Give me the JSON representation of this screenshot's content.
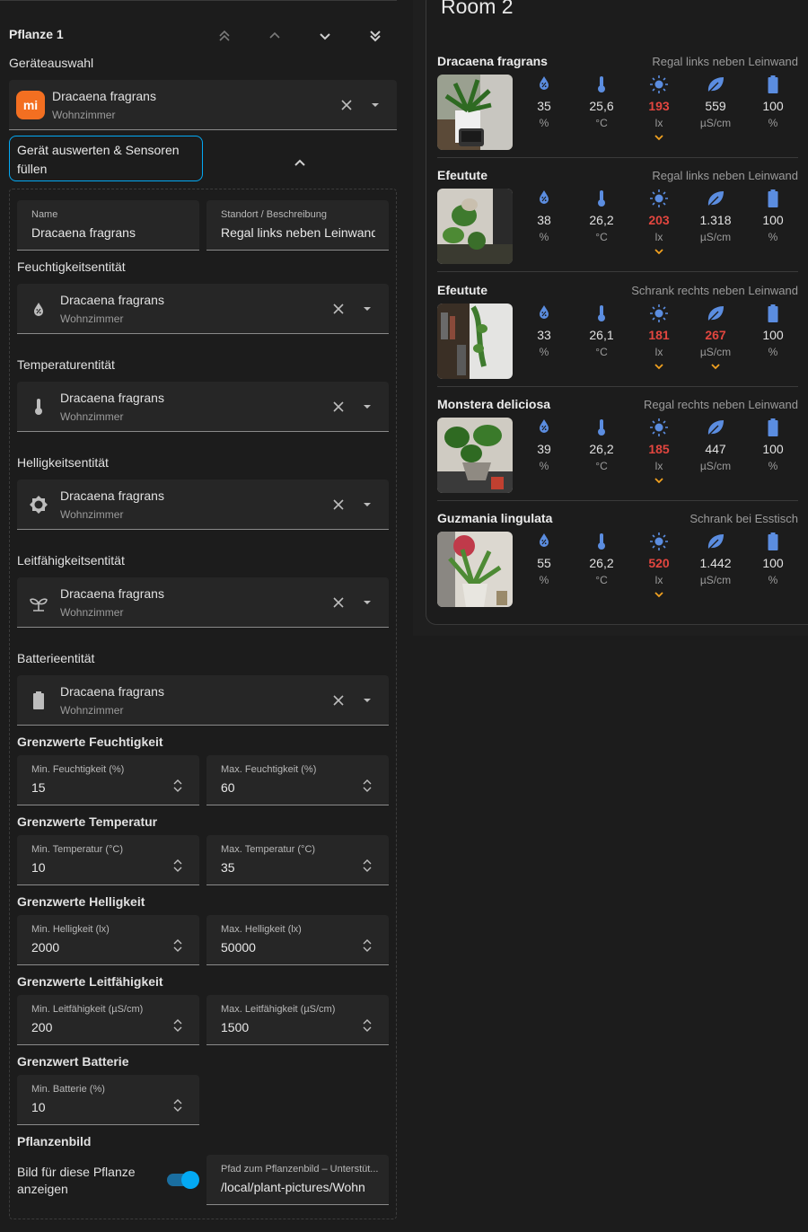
{
  "editor": {
    "plant_title": "Pflanze 1",
    "device_label": "Geräteauswahl",
    "device": {
      "name": "Dracaena fragrans",
      "area": "Wohnzimmer",
      "logo_text": "mi"
    },
    "evaluate_button": "Gerät auswerten & Sensoren füllen",
    "name_field": {
      "label": "Name",
      "value": "Dracaena fragrans"
    },
    "location_field": {
      "label": "Standort / Beschreibung",
      "value": "Regal links neben Leinwand"
    },
    "entities": [
      {
        "label": "Feuchtigkeitsentität",
        "name": "Dracaena fragrans",
        "area": "Wohnzimmer",
        "icon": "humidity-icon"
      },
      {
        "label": "Temperaturentität",
        "name": "Dracaena fragrans",
        "area": "Wohnzimmer",
        "icon": "thermometer-icon"
      },
      {
        "label": "Helligkeitsentität",
        "name": "Dracaena fragrans",
        "area": "Wohnzimmer",
        "icon": "brightness-icon"
      },
      {
        "label": "Leitfähigkeitsentität",
        "name": "Dracaena fragrans",
        "area": "Wohnzimmer",
        "icon": "sprout-icon"
      },
      {
        "label": "Batterieentität",
        "name": "Dracaena fragrans",
        "area": "Wohnzimmer",
        "icon": "battery-icon"
      }
    ],
    "thresholds": [
      {
        "title": "Grenzwerte Feuchtigkeit",
        "min_label": "Min. Feuchtigkeit (%)",
        "min": "15",
        "max_label": "Max. Feuchtigkeit (%)",
        "max": "60"
      },
      {
        "title": "Grenzwerte Temperatur",
        "min_label": "Min. Temperatur (°C)",
        "min": "10",
        "max_label": "Max. Temperatur (°C)",
        "max": "35"
      },
      {
        "title": "Grenzwerte Helligkeit",
        "min_label": "Min. Helligkeit (lx)",
        "min": "2000",
        "max_label": "Max. Helligkeit (lx)",
        "max": "50000"
      },
      {
        "title": "Grenzwerte Leitfähigkeit",
        "min_label": "Min. Leitfähigkeit (µS/cm)",
        "min": "200",
        "max_label": "Max. Leitfähigkeit (µS/cm)",
        "max": "1500"
      }
    ],
    "battery_threshold": {
      "title": "Grenzwert Batterie",
      "min_label": "Min. Batterie (%)",
      "min": "10"
    },
    "image_section": {
      "title": "Pflanzenbild",
      "toggle_label": "Bild für diese Pflanze anzeigen",
      "toggle_on": true,
      "path_label": "Pfad zum Pflanzenbild – Unterstüt...",
      "path_value": "/local/plant-pictures/Wohn"
    }
  },
  "card": {
    "title": "Room 2",
    "units": [
      "%",
      "°C",
      "lx",
      "µS/cm",
      "%"
    ],
    "plants": [
      {
        "name": "Dracaena fragrans",
        "location": "Regal links neben Leinwand",
        "values": [
          "35",
          "25,6",
          "193",
          "559",
          "100"
        ],
        "warn": [
          false,
          false,
          true,
          false,
          false
        ]
      },
      {
        "name": "Efeutute",
        "location": "Regal links neben Leinwand",
        "values": [
          "38",
          "26,2",
          "203",
          "1.318",
          "100"
        ],
        "warn": [
          false,
          false,
          true,
          false,
          false
        ]
      },
      {
        "name": "Efeutute",
        "location": "Schrank rechts neben Leinwand",
        "values": [
          "33",
          "26,1",
          "181",
          "267",
          "100"
        ],
        "warn": [
          false,
          false,
          true,
          true,
          false
        ]
      },
      {
        "name": "Monstera deliciosa",
        "location": "Regal rechts neben Leinwand",
        "values": [
          "39",
          "26,2",
          "185",
          "447",
          "100"
        ],
        "warn": [
          false,
          false,
          true,
          false,
          false
        ]
      },
      {
        "name": "Guzmania lingulata",
        "location": "Schrank bei Esstisch",
        "values": [
          "55",
          "26,2",
          "520",
          "1.442",
          "100"
        ],
        "warn": [
          false,
          false,
          true,
          false,
          false
        ]
      }
    ],
    "colors": {
      "icon": "#5b8de0",
      "warn_value": "#e2463f",
      "warn_caret": "#f0a020",
      "accent": "#03a9f4"
    }
  }
}
